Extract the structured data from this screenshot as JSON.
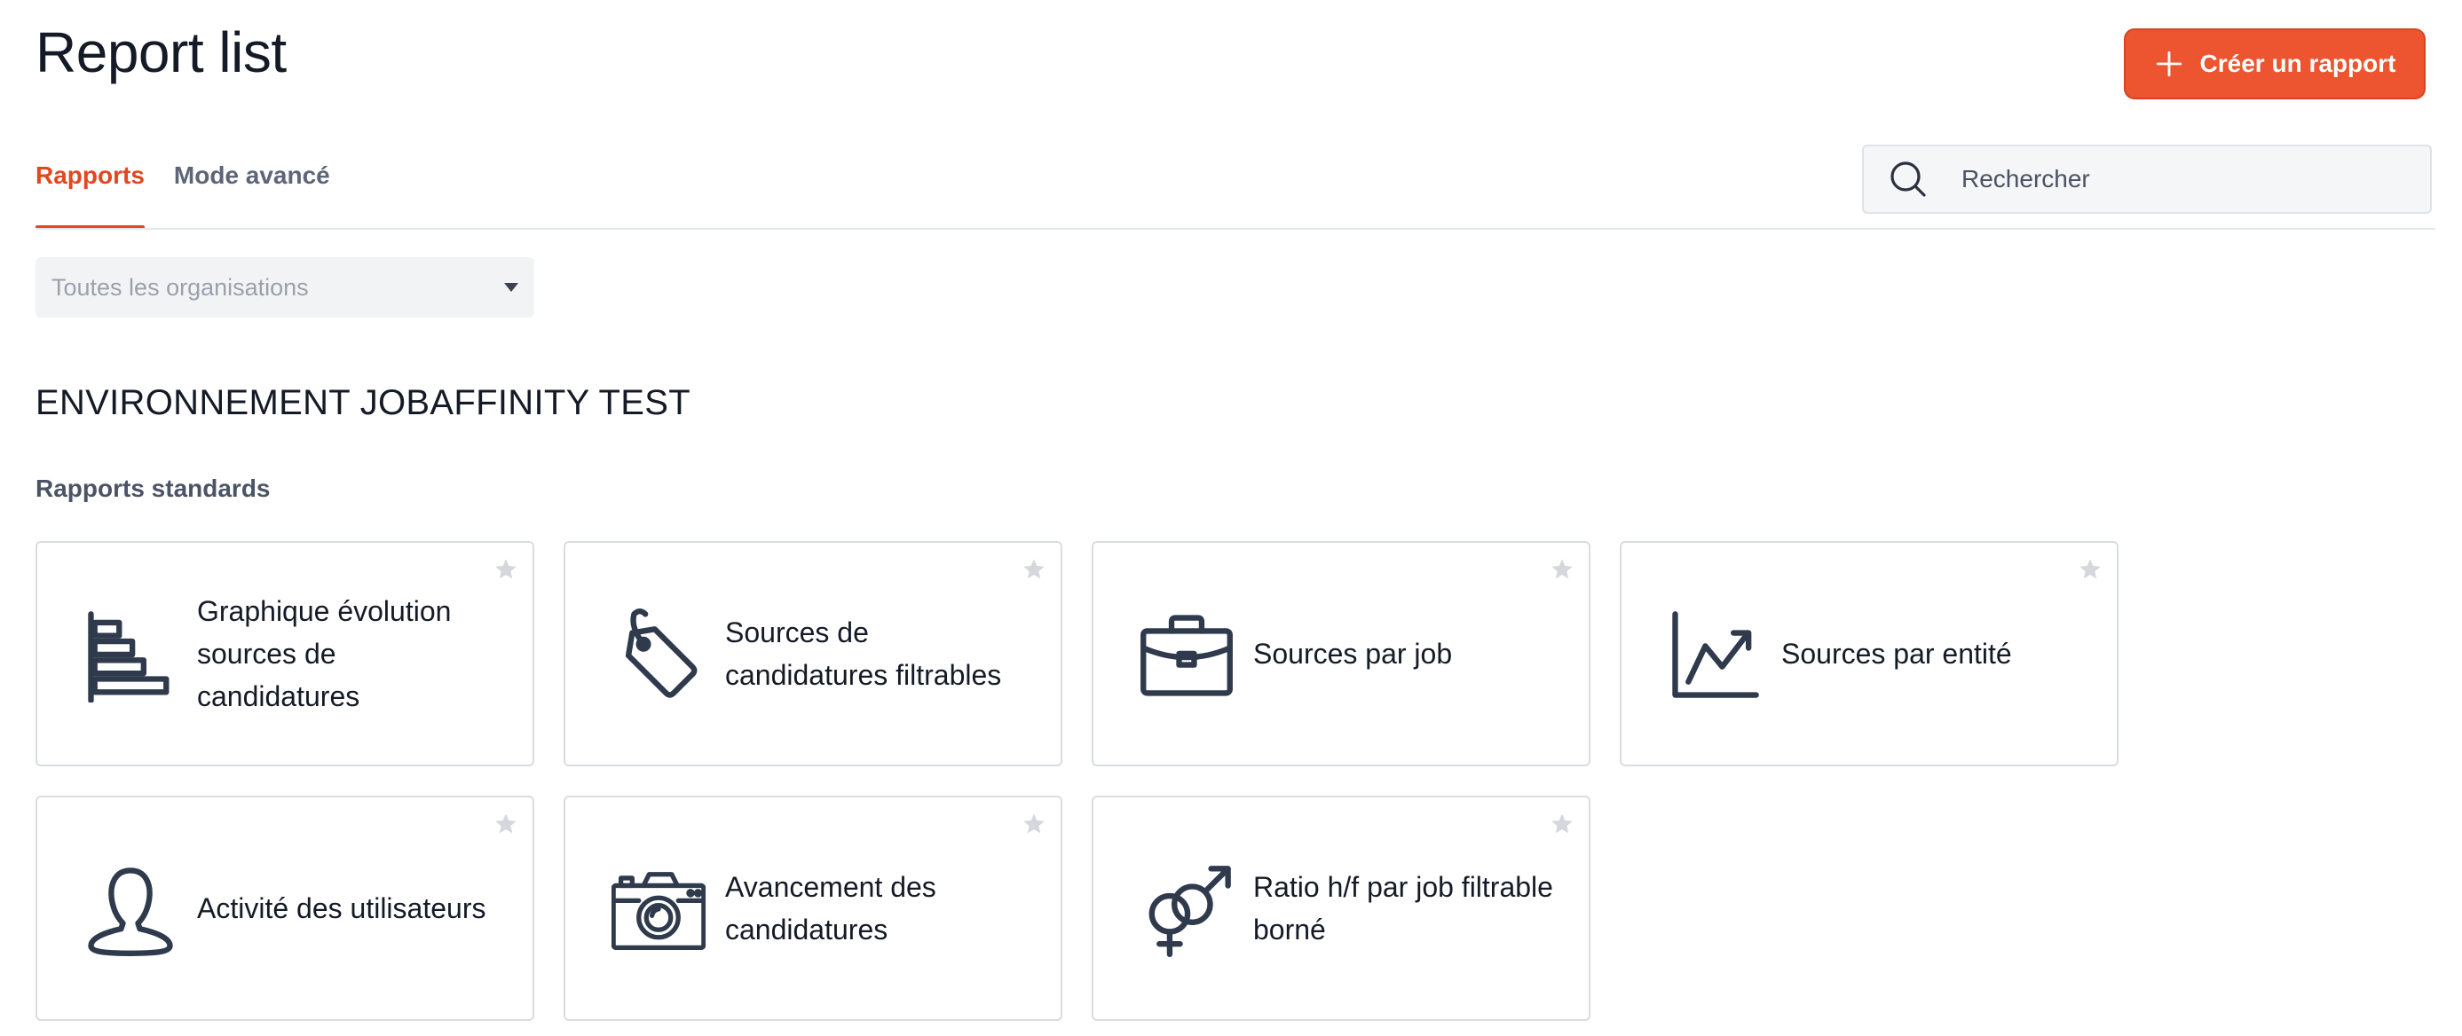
{
  "header": {
    "title": "Report list",
    "create_button_label": "Créer un rapport"
  },
  "tabs": [
    {
      "label": "Rapports",
      "active": true
    },
    {
      "label": "Mode avancé",
      "active": false
    }
  ],
  "search": {
    "placeholder": "Rechercher",
    "value": ""
  },
  "org_filter": {
    "selected": "Toutes les organisations"
  },
  "section": {
    "title": "ENVIRONNEMENT JOBAFFINITY TEST",
    "subtitle": "Rapports standards"
  },
  "reports": [
    {
      "label": "Graphique évolution sources de candidatures",
      "icon": "bar-chart-horizontal-icon",
      "favorite": false
    },
    {
      "label": "Sources de candidatures filtrables",
      "icon": "tag-icon",
      "favorite": false
    },
    {
      "label": "Sources par job",
      "icon": "briefcase-icon",
      "favorite": false
    },
    {
      "label": "Sources par entité",
      "icon": "line-chart-icon",
      "favorite": false
    },
    {
      "label": "Activité des utilisateurs",
      "icon": "user-icon",
      "favorite": false
    },
    {
      "label": "Avancement des candidatures",
      "icon": "camera-icon",
      "favorite": false
    },
    {
      "label": "Ratio h/f par job filtrable borné",
      "icon": "gender-icon",
      "favorite": false
    }
  ],
  "colors": {
    "accent": "#ec5530",
    "active_tab": "#e0481f",
    "icon": "#2f3a4c",
    "star": "#d4d7dc"
  }
}
